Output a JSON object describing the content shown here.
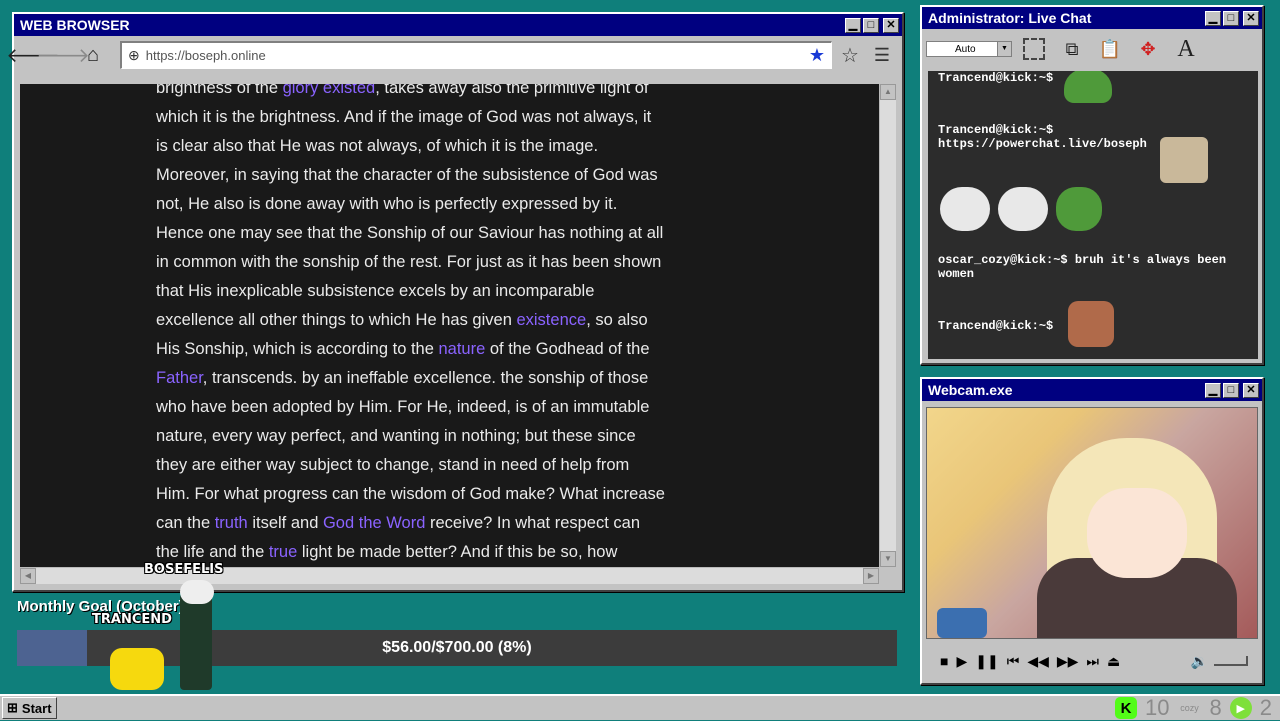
{
  "browser": {
    "title": "WEB BROWSER",
    "url": "https://boseph.online",
    "lines": [
      [
        {
          "t": "brightness of the "
        },
        {
          "t": "glory existed",
          "l": true
        },
        {
          "t": ", takes away also the primitive light of"
        }
      ],
      [
        {
          "t": "which it is the brightness. And if the image of God was not always, it"
        }
      ],
      [
        {
          "t": "is clear also that He was not always, of which it is the image."
        }
      ],
      [
        {
          "t": "Moreover, in saying that the character of the subsistence of God was"
        }
      ],
      [
        {
          "t": "not, He also is done away with who is perfectly expressed by it."
        }
      ],
      [
        {
          "t": "Hence one may see that the Sonship of our Saviour has nothing at all"
        }
      ],
      [
        {
          "t": "in common with the sonship of the rest. For just as it has been shown"
        }
      ],
      [
        {
          "t": "that His inexplicable subsistence excels by an incomparable"
        }
      ],
      [
        {
          "t": "excellence all other things to which He has given "
        },
        {
          "t": "existence",
          "l": true
        },
        {
          "t": ", so also"
        }
      ],
      [
        {
          "t": "His Sonship, which is according to the "
        },
        {
          "t": "nature",
          "l": true
        },
        {
          "t": " of the Godhead of the"
        }
      ],
      [
        {
          "t": "Father",
          "l": true
        },
        {
          "t": ", transcends. by an ineffable excellence. the sonship of those"
        }
      ],
      [
        {
          "t": "who have been adopted by Him. For He, indeed, is of an immutable"
        }
      ],
      [
        {
          "t": "nature, every way perfect, and wanting in nothing; but these since"
        }
      ],
      [
        {
          "t": "they are either way subject to change, stand in need of help from"
        }
      ],
      [
        {
          "t": "Him. For what progress can the wisdom of God make? What increase"
        }
      ],
      [
        {
          "t": "can the "
        },
        {
          "t": "truth",
          "l": true
        },
        {
          "t": " itself and "
        },
        {
          "t": "God the Word",
          "l": true
        },
        {
          "t": " receive? In what respect can"
        }
      ],
      [
        {
          "t": "the life and the "
        },
        {
          "t": "true",
          "l": true
        },
        {
          "t": " light be made better? And if this be so, how"
        }
      ]
    ]
  },
  "chat": {
    "title": "Administrator: Live Chat",
    "select_value": "Auto",
    "messages": [
      {
        "user": "Trancend@kick:~$",
        "text": ""
      },
      {
        "user": "Trancend@kick:~$",
        "text": "https://powerchat.live/boseph"
      },
      {
        "user": "oscar_cozy@kick:~$",
        "text": "bruh it's always been women"
      },
      {
        "user": "Trancend@kick:~$",
        "text": ""
      }
    ]
  },
  "webcam": {
    "title": "Webcam.exe"
  },
  "goal": {
    "title": "Monthly Goal (October)",
    "text": "$56.00/$700.00 (8%)",
    "fraction": 0.08
  },
  "sprites": {
    "a": "BOSEFELIS",
    "b": "TRANCEND"
  },
  "taskbar": {
    "start": "Start",
    "tray_a": "10",
    "tray_b": "8",
    "tray_c": "2",
    "cozy": "cozy"
  }
}
